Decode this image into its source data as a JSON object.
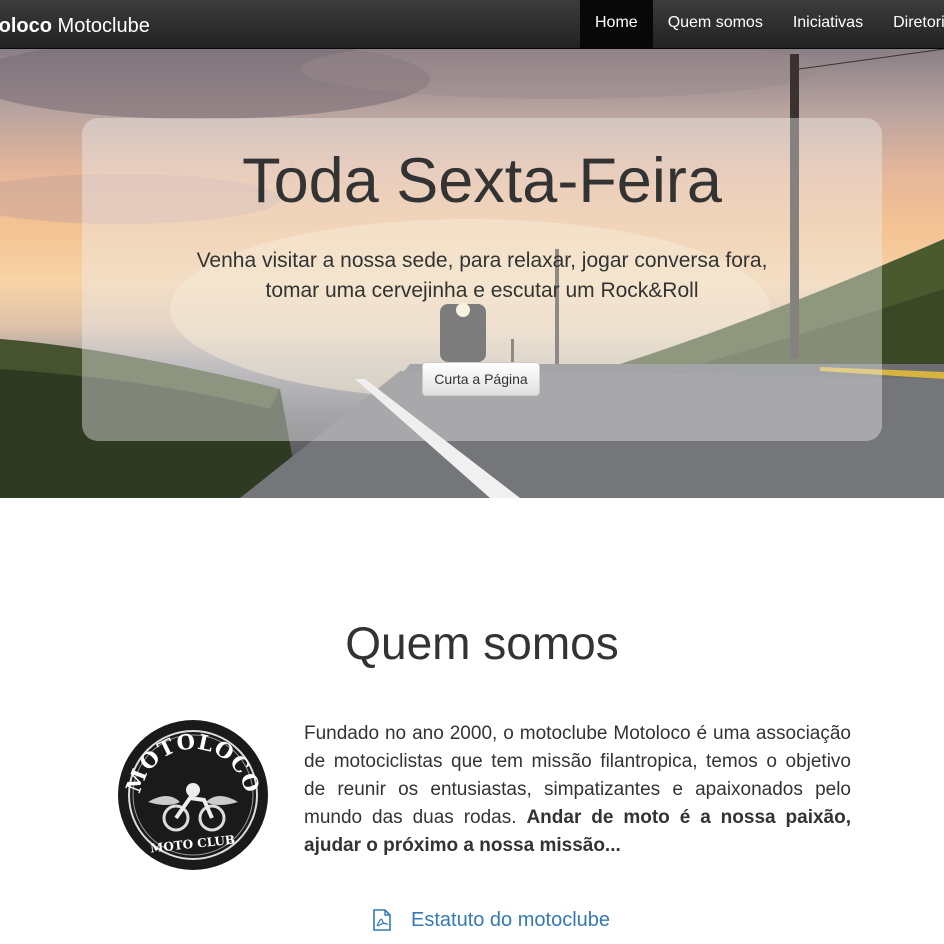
{
  "navbar": {
    "brand_bold": "toloco",
    "brand_rest": " Motoclube",
    "items": [
      {
        "label": "Home",
        "active": true
      },
      {
        "label": "Quem somos"
      },
      {
        "label": "Iniciativas"
      },
      {
        "label": "Diretori"
      }
    ]
  },
  "hero": {
    "title": "Toda Sexta-Feira",
    "subtitle": "Venha visitar a nossa sede, para relaxar, jogar conversa fora, tomar uma cervejinha e escutar um Rock&Roll",
    "button_label": "Curta a Página"
  },
  "about": {
    "title": "Quem somos",
    "text": "Fundado no ano 2000, o motoclube Motoloco é uma associação de motociclistas que tem missão filantropica, temos o objetivo de reunir os entusiastas, simpatizantes e apaixonados pelo mundo das duas rodas. ",
    "text_bold": "Andar de moto é a nossa paixão, ajudar o próximo a nossa missão...",
    "logo": {
      "top": "MOTOLOCO",
      "bottom": "MOTO CLUB"
    },
    "doc_link": "Estatuto do motoclube",
    "doc_icon": "pdf-file-icon"
  }
}
